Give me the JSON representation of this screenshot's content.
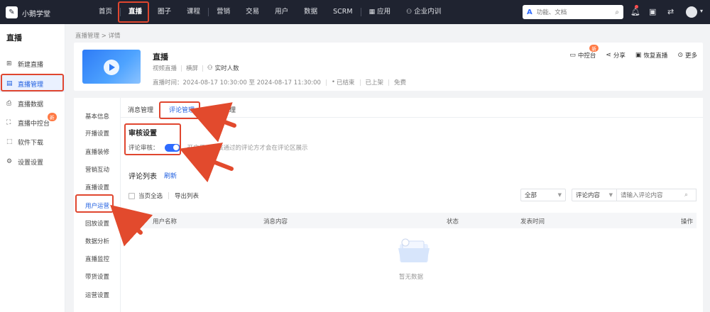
{
  "topbar": {
    "brand": "小鹅学堂",
    "nav": [
      {
        "label": "首页",
        "active": false
      },
      {
        "label": "直播",
        "active": true
      },
      {
        "label": "圈子",
        "active": false
      },
      {
        "label": "课程",
        "active": false
      },
      {
        "label": "营销",
        "active": false
      },
      {
        "label": "交易",
        "active": false
      },
      {
        "label": "用户",
        "active": false
      },
      {
        "label": "数据",
        "active": false
      },
      {
        "label": "SCRM",
        "active": false
      },
      {
        "label": "应用",
        "active": false
      },
      {
        "label": "企业内训",
        "active": false
      }
    ],
    "search_placeholder": "功能、文档",
    "search_logo": "A"
  },
  "sidebar": {
    "title": "直播",
    "items": [
      {
        "label": "新建直播",
        "icon": "new-live-icon"
      },
      {
        "label": "直播管理",
        "icon": "live-manage-icon",
        "active": true
      },
      {
        "label": "直播数据",
        "icon": "live-data-icon"
      },
      {
        "label": "直播中控台",
        "icon": "console-icon",
        "badge": "新"
      },
      {
        "label": "软件下载",
        "icon": "download-icon"
      },
      {
        "label": "设置设置",
        "icon": "settings-icon"
      }
    ]
  },
  "breadcrumb": "直播管理 > 详情",
  "live": {
    "title": "直播",
    "type": "视频直播",
    "mode": "横屏",
    "viewers": "实时人数",
    "time_label": "直播时间：",
    "time_value": "2024-08-17 10:30:00 至 2024-08-17 11:30:00",
    "status": "已结束",
    "shelf": "已上架",
    "price": "免费",
    "actions": [
      {
        "label": "中控台",
        "icon": "monitor-icon",
        "badge": "新"
      },
      {
        "label": "分享",
        "icon": "share-icon"
      },
      {
        "label": "恢复直播",
        "icon": "restore-icon"
      },
      {
        "label": "更多",
        "icon": "more-icon"
      }
    ]
  },
  "subnav": [
    "基本信息",
    "开播设置",
    "直播装修",
    "营销互动",
    "直播设置",
    "用户运营",
    "回放设置",
    "数据分析",
    "直播监控",
    "带货设置",
    "运营设置"
  ],
  "subnav_active": 5,
  "tabs": [
    {
      "label": "消息管理",
      "active": false
    },
    {
      "label": "评论管理",
      "active": true
    },
    {
      "label": "用户管理",
      "active": false
    }
  ],
  "audit": {
    "title": "审核设置",
    "label": "评论审核：",
    "enabled": true,
    "hint": "开启后，审核通过的评论方才会在评论区展示"
  },
  "comment_list": {
    "title": "评论列表",
    "refresh": "刷新",
    "select_page": "当页全选",
    "export": "导出列表",
    "filter_all": "全部",
    "filter_field": "评论内容",
    "search_placeholder": "请输入评论内容",
    "columns": [
      "用户名称",
      "消息内容",
      "状态",
      "发表时间",
      "操作"
    ],
    "empty_text": "暂无数据"
  }
}
